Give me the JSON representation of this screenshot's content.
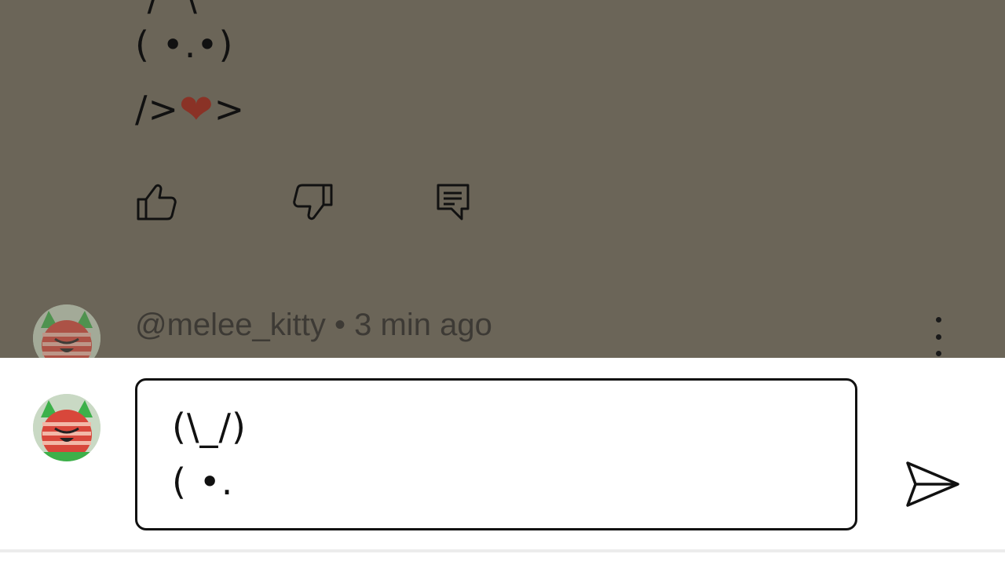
{
  "comment": {
    "art_top": " /  \\",
    "art_face": "( •.•)",
    "art_body_prefix": "/>",
    "art_heart": "❤",
    "art_body_suffix": ">",
    "actions": {
      "like_icon": "thumbs-up-icon",
      "dislike_icon": "thumbs-down-icon",
      "reply_icon": "reply-icon"
    }
  },
  "next_comment": {
    "username": "@melee_kitty",
    "separator": " • ",
    "time": "3 min ago",
    "more_icon": "more-vertical-icon"
  },
  "composer": {
    "input_line_1": "(\\_/)",
    "input_line_2": "( •.",
    "send_icon": "send-icon"
  },
  "colors": {
    "overlay": "#6b6558",
    "heart": "#8a3226",
    "avatar_red": "#d8473b",
    "avatar_green": "#3db04a"
  }
}
